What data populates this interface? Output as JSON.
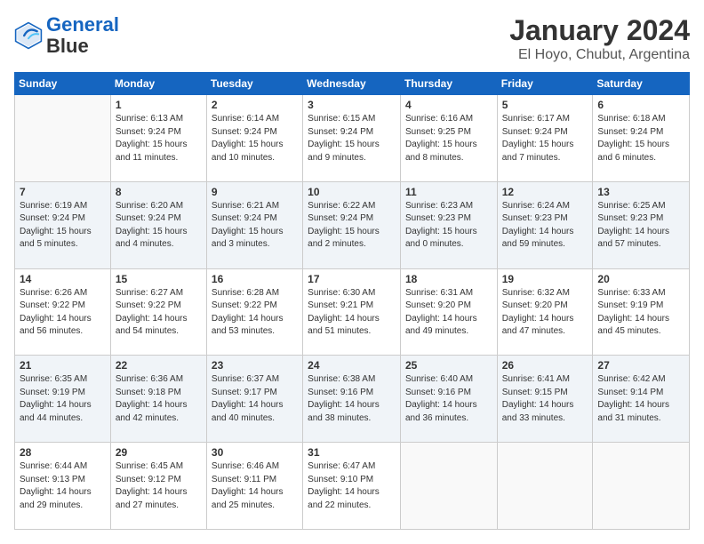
{
  "header": {
    "logo_line1": "General",
    "logo_line2": "Blue",
    "month": "January 2024",
    "location": "El Hoyo, Chubut, Argentina"
  },
  "days_of_week": [
    "Sunday",
    "Monday",
    "Tuesday",
    "Wednesday",
    "Thursday",
    "Friday",
    "Saturday"
  ],
  "weeks": [
    [
      {
        "day": "",
        "lines": []
      },
      {
        "day": "1",
        "lines": [
          "Sunrise: 6:13 AM",
          "Sunset: 9:24 PM",
          "Daylight: 15 hours",
          "and 11 minutes."
        ]
      },
      {
        "day": "2",
        "lines": [
          "Sunrise: 6:14 AM",
          "Sunset: 9:24 PM",
          "Daylight: 15 hours",
          "and 10 minutes."
        ]
      },
      {
        "day": "3",
        "lines": [
          "Sunrise: 6:15 AM",
          "Sunset: 9:24 PM",
          "Daylight: 15 hours",
          "and 9 minutes."
        ]
      },
      {
        "day": "4",
        "lines": [
          "Sunrise: 6:16 AM",
          "Sunset: 9:25 PM",
          "Daylight: 15 hours",
          "and 8 minutes."
        ]
      },
      {
        "day": "5",
        "lines": [
          "Sunrise: 6:17 AM",
          "Sunset: 9:24 PM",
          "Daylight: 15 hours",
          "and 7 minutes."
        ]
      },
      {
        "day": "6",
        "lines": [
          "Sunrise: 6:18 AM",
          "Sunset: 9:24 PM",
          "Daylight: 15 hours",
          "and 6 minutes."
        ]
      }
    ],
    [
      {
        "day": "7",
        "lines": [
          "Sunrise: 6:19 AM",
          "Sunset: 9:24 PM",
          "Daylight: 15 hours",
          "and 5 minutes."
        ]
      },
      {
        "day": "8",
        "lines": [
          "Sunrise: 6:20 AM",
          "Sunset: 9:24 PM",
          "Daylight: 15 hours",
          "and 4 minutes."
        ]
      },
      {
        "day": "9",
        "lines": [
          "Sunrise: 6:21 AM",
          "Sunset: 9:24 PM",
          "Daylight: 15 hours",
          "and 3 minutes."
        ]
      },
      {
        "day": "10",
        "lines": [
          "Sunrise: 6:22 AM",
          "Sunset: 9:24 PM",
          "Daylight: 15 hours",
          "and 2 minutes."
        ]
      },
      {
        "day": "11",
        "lines": [
          "Sunrise: 6:23 AM",
          "Sunset: 9:23 PM",
          "Daylight: 15 hours",
          "and 0 minutes."
        ]
      },
      {
        "day": "12",
        "lines": [
          "Sunrise: 6:24 AM",
          "Sunset: 9:23 PM",
          "Daylight: 14 hours",
          "and 59 minutes."
        ]
      },
      {
        "day": "13",
        "lines": [
          "Sunrise: 6:25 AM",
          "Sunset: 9:23 PM",
          "Daylight: 14 hours",
          "and 57 minutes."
        ]
      }
    ],
    [
      {
        "day": "14",
        "lines": [
          "Sunrise: 6:26 AM",
          "Sunset: 9:22 PM",
          "Daylight: 14 hours",
          "and 56 minutes."
        ]
      },
      {
        "day": "15",
        "lines": [
          "Sunrise: 6:27 AM",
          "Sunset: 9:22 PM",
          "Daylight: 14 hours",
          "and 54 minutes."
        ]
      },
      {
        "day": "16",
        "lines": [
          "Sunrise: 6:28 AM",
          "Sunset: 9:22 PM",
          "Daylight: 14 hours",
          "and 53 minutes."
        ]
      },
      {
        "day": "17",
        "lines": [
          "Sunrise: 6:30 AM",
          "Sunset: 9:21 PM",
          "Daylight: 14 hours",
          "and 51 minutes."
        ]
      },
      {
        "day": "18",
        "lines": [
          "Sunrise: 6:31 AM",
          "Sunset: 9:20 PM",
          "Daylight: 14 hours",
          "and 49 minutes."
        ]
      },
      {
        "day": "19",
        "lines": [
          "Sunrise: 6:32 AM",
          "Sunset: 9:20 PM",
          "Daylight: 14 hours",
          "and 47 minutes."
        ]
      },
      {
        "day": "20",
        "lines": [
          "Sunrise: 6:33 AM",
          "Sunset: 9:19 PM",
          "Daylight: 14 hours",
          "and 45 minutes."
        ]
      }
    ],
    [
      {
        "day": "21",
        "lines": [
          "Sunrise: 6:35 AM",
          "Sunset: 9:19 PM",
          "Daylight: 14 hours",
          "and 44 minutes."
        ]
      },
      {
        "day": "22",
        "lines": [
          "Sunrise: 6:36 AM",
          "Sunset: 9:18 PM",
          "Daylight: 14 hours",
          "and 42 minutes."
        ]
      },
      {
        "day": "23",
        "lines": [
          "Sunrise: 6:37 AM",
          "Sunset: 9:17 PM",
          "Daylight: 14 hours",
          "and 40 minutes."
        ]
      },
      {
        "day": "24",
        "lines": [
          "Sunrise: 6:38 AM",
          "Sunset: 9:16 PM",
          "Daylight: 14 hours",
          "and 38 minutes."
        ]
      },
      {
        "day": "25",
        "lines": [
          "Sunrise: 6:40 AM",
          "Sunset: 9:16 PM",
          "Daylight: 14 hours",
          "and 36 minutes."
        ]
      },
      {
        "day": "26",
        "lines": [
          "Sunrise: 6:41 AM",
          "Sunset: 9:15 PM",
          "Daylight: 14 hours",
          "and 33 minutes."
        ]
      },
      {
        "day": "27",
        "lines": [
          "Sunrise: 6:42 AM",
          "Sunset: 9:14 PM",
          "Daylight: 14 hours",
          "and 31 minutes."
        ]
      }
    ],
    [
      {
        "day": "28",
        "lines": [
          "Sunrise: 6:44 AM",
          "Sunset: 9:13 PM",
          "Daylight: 14 hours",
          "and 29 minutes."
        ]
      },
      {
        "day": "29",
        "lines": [
          "Sunrise: 6:45 AM",
          "Sunset: 9:12 PM",
          "Daylight: 14 hours",
          "and 27 minutes."
        ]
      },
      {
        "day": "30",
        "lines": [
          "Sunrise: 6:46 AM",
          "Sunset: 9:11 PM",
          "Daylight: 14 hours",
          "and 25 minutes."
        ]
      },
      {
        "day": "31",
        "lines": [
          "Sunrise: 6:47 AM",
          "Sunset: 9:10 PM",
          "Daylight: 14 hours",
          "and 22 minutes."
        ]
      },
      {
        "day": "",
        "lines": []
      },
      {
        "day": "",
        "lines": []
      },
      {
        "day": "",
        "lines": []
      }
    ]
  ]
}
